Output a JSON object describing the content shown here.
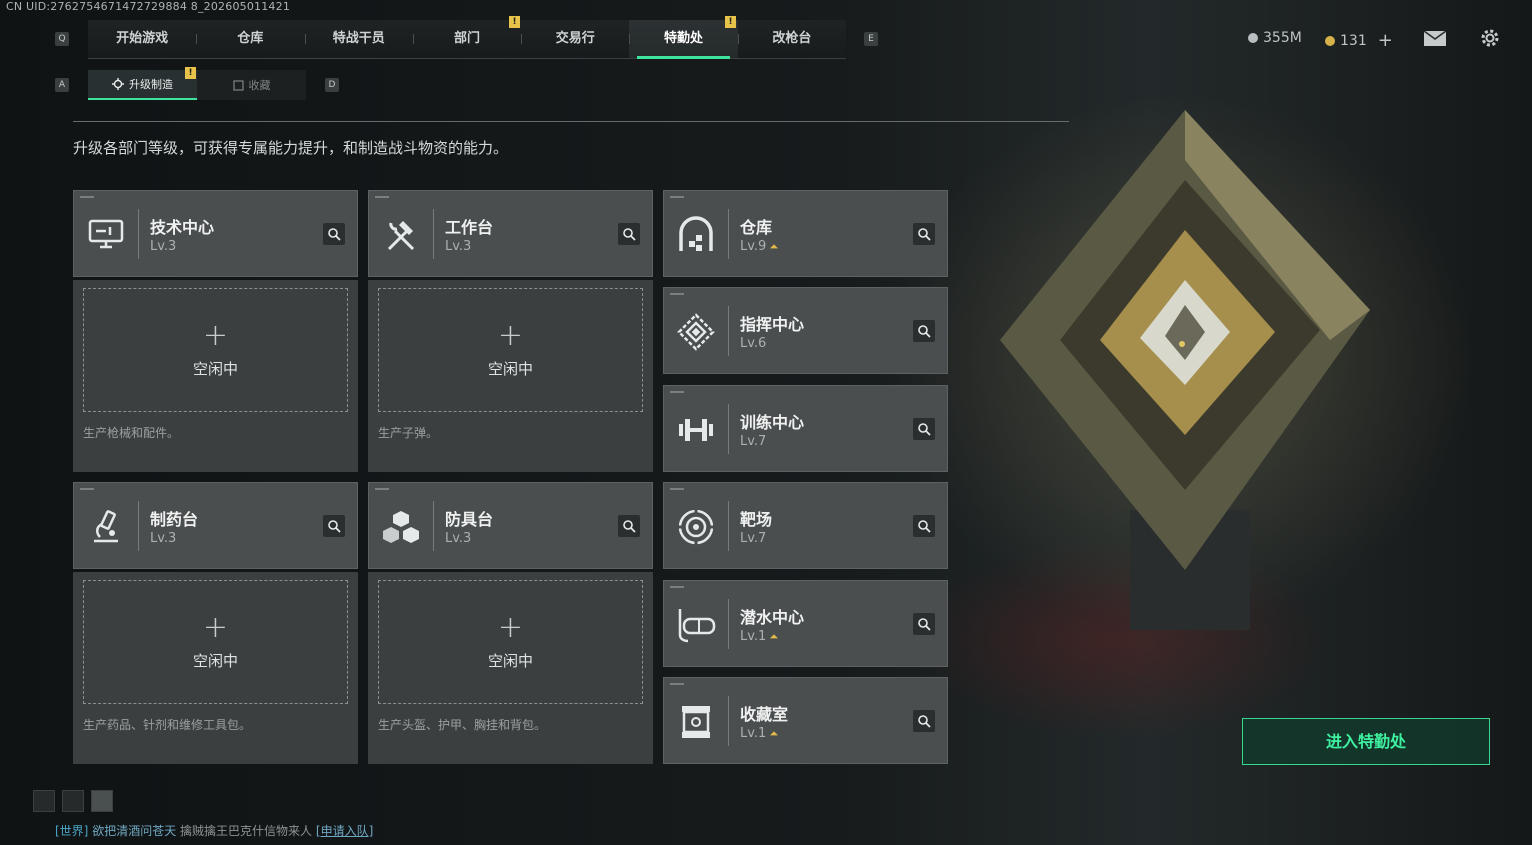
{
  "uid": "CN UID:2762754671472729884 8_202605011421",
  "nav": {
    "prev_key": "Q",
    "next_key": "E",
    "alert": "!",
    "tabs": [
      "开始游戏",
      "仓库",
      "特战干员",
      "部门",
      "交易行",
      "特勤处",
      "改枪台"
    ],
    "active": "特勤处"
  },
  "subnav": {
    "prev_key": "A",
    "next_key": "D",
    "tabs": [
      "升级制造",
      "收藏"
    ],
    "active": "升级制造"
  },
  "hud": {
    "coins": "355M",
    "tokens": "131"
  },
  "description": "升级各部门等级，可获得专属能力提升，和制造战斗物资的能力。",
  "departments": [
    {
      "name": "技术中心",
      "level": "Lv.3",
      "icon": "monitor-icon"
    },
    {
      "name": "工作台",
      "level": "Lv.3",
      "icon": "hammer-wrench-icon"
    },
    {
      "name": "制药台",
      "level": "Lv.3",
      "icon": "microscope-icon"
    },
    {
      "name": "防具台",
      "level": "Lv.3",
      "icon": "cubes-icon"
    },
    {
      "name": "仓库",
      "level": "Lv.9",
      "icon": "vault-icon",
      "upgradable": true
    },
    {
      "name": "指挥中心",
      "level": "Lv.6",
      "icon": "command-emblem-icon"
    },
    {
      "name": "训练中心",
      "level": "Lv.7",
      "icon": "dumbbell-icon"
    },
    {
      "name": "靶场",
      "level": "Lv.7",
      "icon": "target-icon"
    },
    {
      "name": "潜水中心",
      "level": "Lv.1",
      "icon": "diving-mask-icon",
      "upgradable": true
    },
    {
      "name": "收藏室",
      "level": "Lv.1",
      "icon": "display-case-icon",
      "upgradable": true
    }
  ],
  "slots": [
    {
      "status": "空闲中",
      "note": "生产枪械和配件。"
    },
    {
      "status": "空闲中",
      "note": "生产子弹。"
    },
    {
      "status": "空闲中",
      "note": "生产药品、针剂和维修工具包。"
    },
    {
      "status": "空闲中",
      "note": "生产头盔、护甲、胸挂和背包。"
    }
  ],
  "enter_button": "进入特勤处",
  "chat": {
    "channel": "[世界]",
    "user": "欲把清酒问苍天",
    "message": "擒贼擒王巴克什信物来人",
    "link": "[申请入队]"
  },
  "colors": {
    "accent": "#3ee49e",
    "alert": "#e7c34a",
    "upgrade": "#e2b94a"
  }
}
